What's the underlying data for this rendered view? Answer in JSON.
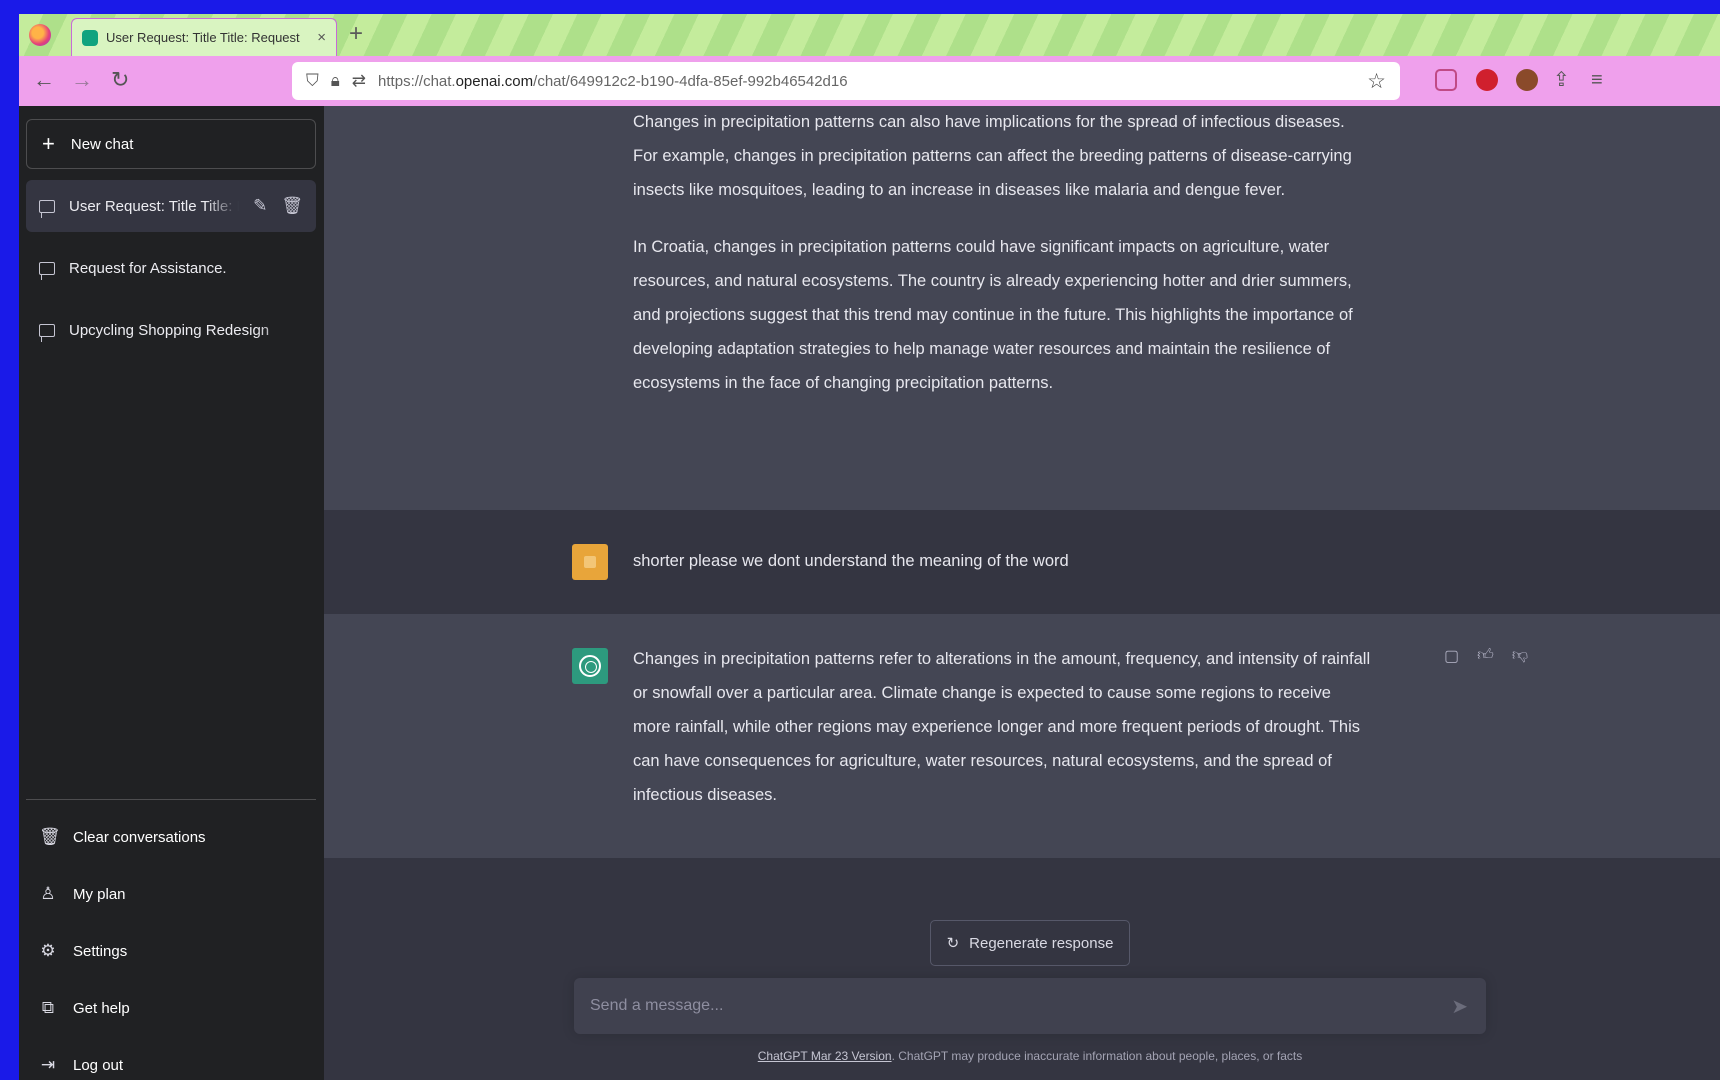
{
  "browser": {
    "tab_title": "User Request: Title Title: Request",
    "tab_close": "×",
    "new_tab": "+",
    "url_prefix": "https://chat.",
    "url_domain": "openai.com",
    "url_path": "/chat/649912c2-b190-4dfa-85ef-992b46542d16"
  },
  "sidebar": {
    "new_chat_label": "New chat",
    "history": [
      {
        "label": "User Request: Title Title: Request"
      },
      {
        "label": "Request for Assistance."
      },
      {
        "label": "Upcycling Shopping Redesign"
      }
    ],
    "menu": [
      {
        "label": "Clear conversations",
        "icon": "trash-icon"
      },
      {
        "label": "My plan",
        "icon": "user-icon"
      },
      {
        "label": "Settings",
        "icon": "gear-icon"
      },
      {
        "label": "Get help",
        "icon": "external-link-icon"
      },
      {
        "label": "Log out",
        "icon": "logout-icon"
      }
    ]
  },
  "conversation": {
    "assistant_1": {
      "paragraphs": [
        "Changes in precipitation patterns can also have implications for the spread of infectious diseases. For example, changes in precipitation patterns can affect the breeding patterns of disease-carrying insects like mosquitoes, leading to an increase in diseases like malaria and dengue fever.",
        "In Croatia, changes in precipitation patterns could have significant impacts on agriculture, water resources, and natural ecosystems. The country is already experiencing hotter and drier summers, and projections suggest that this trend may continue in the future. This highlights the importance of developing adaptation strategies to help manage water resources and maintain the resilience of ecosystems in the face of changing precipitation patterns."
      ]
    },
    "user_1": {
      "text": "shorter please we dont understand the meaning of the word"
    },
    "assistant_2": {
      "text": "Changes in precipitation patterns refer to alterations in the amount, frequency, and intensity of rainfall or snowfall over a particular area. Climate change is expected to cause some regions to receive more rainfall, while other regions may experience longer and more frequent periods of drought. This can have consequences for agriculture, water resources, natural ecosystems, and the spread of infectious diseases."
    }
  },
  "composer": {
    "regenerate_label": "Regenerate response",
    "placeholder": "Send a message...",
    "footer_link": "ChatGPT Mar 23 Version",
    "footer_text": ". ChatGPT may produce inaccurate information about people, places, or facts"
  },
  "colors": {
    "sidebar_bg": "#202123",
    "assistant_bg": "#444654",
    "user_bg": "#343541",
    "user_avatar": "#e8a53a",
    "gpt_avatar": "#2d9a7e"
  }
}
